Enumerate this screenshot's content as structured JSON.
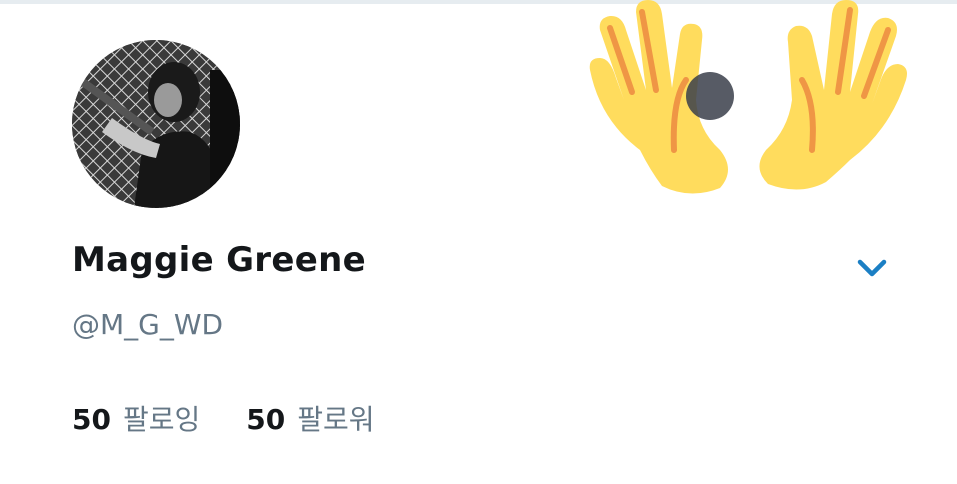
{
  "profile": {
    "display_name": "Maggie Greene",
    "handle": "@M_G_WD",
    "avatar_icon": "profile-photo",
    "following_count": "50",
    "following_label": "팔로잉",
    "followers_count": "50",
    "followers_label": "팔로워"
  },
  "decoration": {
    "emoji": "raising-hands-emoji"
  },
  "controls": {
    "account_switcher_icon": "chevron-down-icon"
  },
  "colors": {
    "accent": "#1da1f2",
    "chevron": "#1b7fc4",
    "text_primary": "#14171a",
    "text_secondary": "#657786",
    "emoji_fill": "#ffdc5d",
    "emoji_lines": "#ef9645"
  }
}
